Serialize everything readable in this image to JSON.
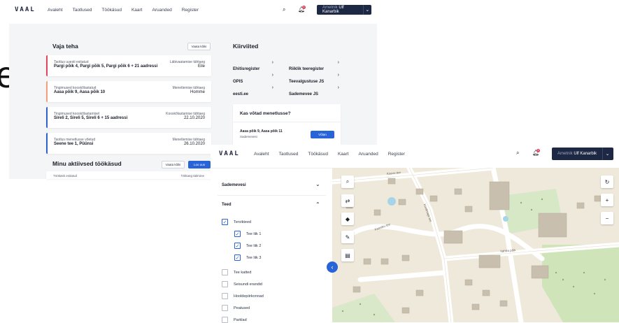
{
  "top": {
    "logo": "VAAL",
    "nav": [
      "Avaleht",
      "Taotlused",
      "Töökäsud",
      "Kaart",
      "Aruanded",
      "Register"
    ],
    "user_role": "Ametnik",
    "user_name": "Ulf Kanarbik",
    "notif_count": "3"
  },
  "left_fragment": "e",
  "todo": {
    "title": "Vaja teha",
    "view_all": "Vaata kõiki",
    "items": [
      {
        "label": "Taotlus uuesti esitatud",
        "value": "Pargi põik 4, Pargi põik 5, Pargi põik 6 + 21 aadressi",
        "rlabel": "Läbivaatamise tähtaeg",
        "rvalue": "Eile",
        "color": "#e0445e"
      },
      {
        "label": "Tingimused kooskõlastatud",
        "value": "Aasa põik 9, Aasa põik 10",
        "rlabel": "Menetlemise tähtaeg",
        "rvalue": "Homme",
        "color": "#f0a07a"
      },
      {
        "label": "Tingimused kooskõlastamisel",
        "value": "Sireli 2, Sireli 5, Sireli 6 + 15 aadressi",
        "rlabel": "Kooskõlastamise tähtaeg",
        "rvalue": "22.10.2020",
        "color": "#2d63c8"
      },
      {
        "label": "Taotlus menetlusse võetud",
        "value": "Seene tee 1, Püünsi",
        "rlabel": "Menetlemise tähtaeg",
        "rvalue": "26.10.2020",
        "color": "#2d63c8"
      }
    ]
  },
  "quick": {
    "title": "Kiirviited",
    "links": [
      "Ehitisregister",
      "Riiklik teeregister",
      "OPIS",
      "Teevalgustuse JS",
      "eesti.ee",
      "Sademevee JS"
    ]
  },
  "proposal": {
    "title": "Kas võtad menetlusse?",
    "address": "Aasa põik 9, Aasa põik 11",
    "sub": "Sademevesi",
    "action": "Võtan"
  },
  "active": {
    "title": "Minu aktiivsed töökäsud",
    "view_all": "Vaata kõiki",
    "create": "Loo uus",
    "row_label": "Töökäsk esitatud",
    "row_rlabel": "Tähtaeg täitmine"
  },
  "layers": {
    "sademevesi": "Sademevesi",
    "teed": "Teed",
    "items": [
      {
        "label": "Tervikteed",
        "checked": true,
        "indent": false
      },
      {
        "label": "Tee liik 1",
        "checked": true,
        "indent": true
      },
      {
        "label": "Tee liik 2",
        "checked": true,
        "indent": true
      },
      {
        "label": "Tee liik 3",
        "checked": true,
        "indent": true
      },
      {
        "label": "Tee katted",
        "checked": false,
        "indent": false
      },
      {
        "label": "Seisundi erandid",
        "checked": false,
        "indent": false
      },
      {
        "label": "Hooldepiirkonnad",
        "checked": false,
        "indent": false
      },
      {
        "label": "Peatused",
        "checked": false,
        "indent": false
      },
      {
        "label": "Parklad",
        "checked": false,
        "indent": false
      }
    ]
  },
  "map": {
    "streets": [
      "Kasvu tee",
      "Koolimaja tee",
      "Vahtra põik",
      "Kaasiku tee"
    ]
  },
  "colors": {
    "accent": "#2864d8",
    "navy": "#1d2944",
    "panel": "#f4f5f7"
  }
}
